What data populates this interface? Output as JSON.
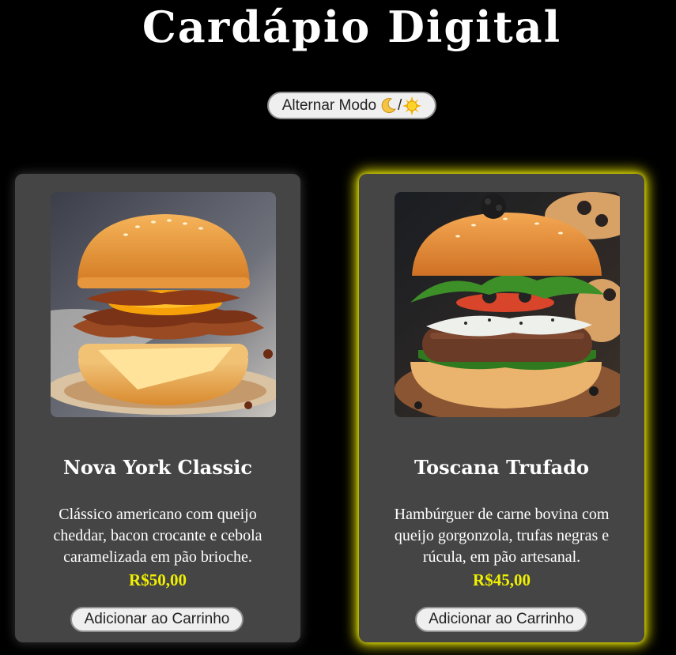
{
  "header": {
    "title": "Cardápio Digital"
  },
  "theme_toggle": {
    "label": "Alternar Modo",
    "separator": "/",
    "icons": [
      "moon-icon",
      "sun-icon"
    ]
  },
  "colors": {
    "background": "#000000",
    "card_background": "#454545",
    "price": "#f0f000",
    "highlight_glow": "#e5e200"
  },
  "products": [
    {
      "name": "Nova York Classic",
      "description": "Clássico americano com queijo cheddar, bacon crocante e cebola caramelizada em pão brioche.",
      "price": "R$50,00",
      "button_label": "Adicionar ao Carrinho",
      "image_icon": "bacon-cheeseburger-photo",
      "highlighted": false
    },
    {
      "name": "Toscana Trufado",
      "description": "Hambúrguer de carne bovina com queijo gorgonzola, trufas negras e rúcula, em pão artesanal.",
      "price": "R$45,00",
      "button_label": "Adicionar ao Carrinho",
      "image_icon": "truffle-burger-photo",
      "highlighted": true
    }
  ]
}
